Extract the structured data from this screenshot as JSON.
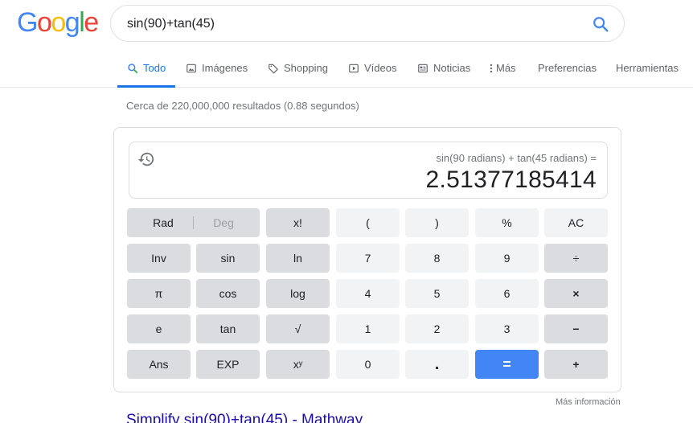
{
  "logo": {
    "letters": [
      "G",
      "o",
      "o",
      "g",
      "l",
      "e"
    ],
    "colors": [
      "#4285F4",
      "#EA4335",
      "#FBBC05",
      "#4285F4",
      "#34A853",
      "#EA4335"
    ]
  },
  "search": {
    "query": "sin(90)+tan(45)"
  },
  "tabs": [
    {
      "label": "Todo",
      "icon": "search-icon"
    },
    {
      "label": "Imágenes",
      "icon": "image-icon"
    },
    {
      "label": "Shopping",
      "icon": "tag-icon"
    },
    {
      "label": "Vídeos",
      "icon": "play-icon"
    },
    {
      "label": "Noticias",
      "icon": "news-icon"
    },
    {
      "label": "Más",
      "icon": "more-vert-icon"
    },
    {
      "label": "Preferencias"
    },
    {
      "label": "Herramientas"
    }
  ],
  "stats": "Cerca de 220,000,000 resultados (0.88 segundos)",
  "calculator": {
    "expression": "sin(90 radians) + tan(45 radians) =",
    "result": "2.51377185414",
    "rad": "Rad",
    "deg": "Deg",
    "keys": {
      "fact": "x!",
      "lparen": "(",
      "rparen": ")",
      "percent": "%",
      "ac": "AC",
      "inv": "Inv",
      "sin": "sin",
      "ln": "ln",
      "k7": "7",
      "k8": "8",
      "k9": "9",
      "divide": "÷",
      "pi": "π",
      "cos": "cos",
      "log": "log",
      "k4": "4",
      "k5": "5",
      "k6": "6",
      "multiply": "×",
      "e": "e",
      "tan": "tan",
      "sqrt": "√",
      "k1": "1",
      "k2": "2",
      "k3": "3",
      "minus": "−",
      "ans": "Ans",
      "exp": "EXP",
      "pow": "xʸ",
      "k0": "0",
      "dot": ".",
      "equals": "=",
      "plus": "+"
    }
  },
  "more_info": "Más información",
  "first_result": "Simplify sin(90)+tan(45) - Mathway"
}
